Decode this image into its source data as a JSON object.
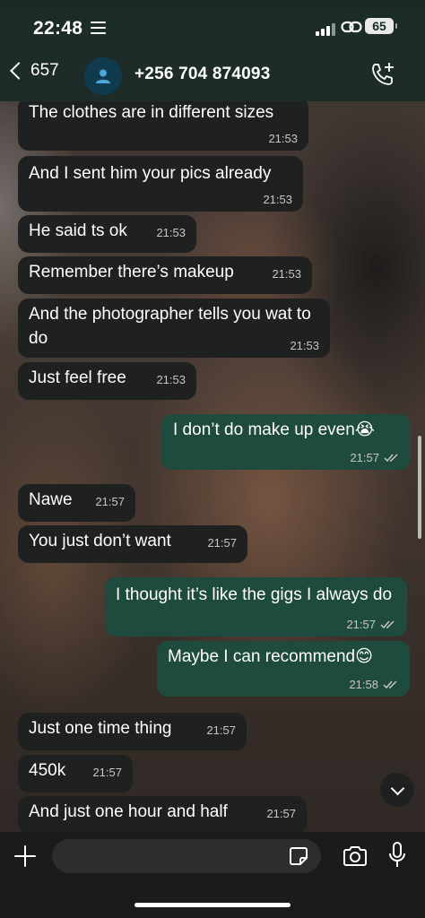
{
  "status_bar": {
    "time": "22:48",
    "battery": "65"
  },
  "header": {
    "back_count": "657",
    "contact": "+256 704 874093"
  },
  "messages": [
    {
      "text": "The clothes are in different sizes",
      "time": "21:53",
      "direction": "in"
    },
    {
      "text": "And I sent him your pics already",
      "time": "21:53",
      "direction": "in"
    },
    {
      "text": "He said ts ok",
      "time": "21:53",
      "direction": "in"
    },
    {
      "text": "Remember there’s makeup",
      "time": "21:53",
      "direction": "in"
    },
    {
      "text": "And the photographer tells you wat to do",
      "time": "21:53",
      "direction": "in"
    },
    {
      "text": "Just feel free",
      "time": "21:53",
      "direction": "in"
    },
    {
      "text": "I don’t do make up even😭",
      "time": "21:57",
      "direction": "out"
    },
    {
      "text": "Nawe",
      "time": "21:57",
      "direction": "in"
    },
    {
      "text": "You just don’t want",
      "time": "21:57",
      "direction": "in"
    },
    {
      "text": "I thought it’s like the gigs I always do",
      "time": "21:57",
      "direction": "out"
    },
    {
      "text": "Maybe I can recommend😊",
      "time": "21:58",
      "direction": "out"
    },
    {
      "text": "Just one time thing",
      "time": "21:57",
      "direction": "in"
    },
    {
      "text": "450k",
      "time": "21:57",
      "direction": "in"
    },
    {
      "text": "And just one hour and half",
      "time": "21:57",
      "direction": "in"
    }
  ],
  "input": {
    "placeholder": ""
  },
  "icons": {
    "list": "list-icon",
    "link": "link-icon",
    "avatar": "person-icon",
    "call": "phone-add-icon",
    "plus": "plus-icon",
    "sticker": "sticker-icon",
    "camera": "camera-icon",
    "mic": "mic-icon",
    "scroll_down": "chevron-down-icon"
  },
  "colors": {
    "incoming": "#1e2120",
    "outgoing": "#1f4a3e",
    "header": "#1d2c28"
  }
}
